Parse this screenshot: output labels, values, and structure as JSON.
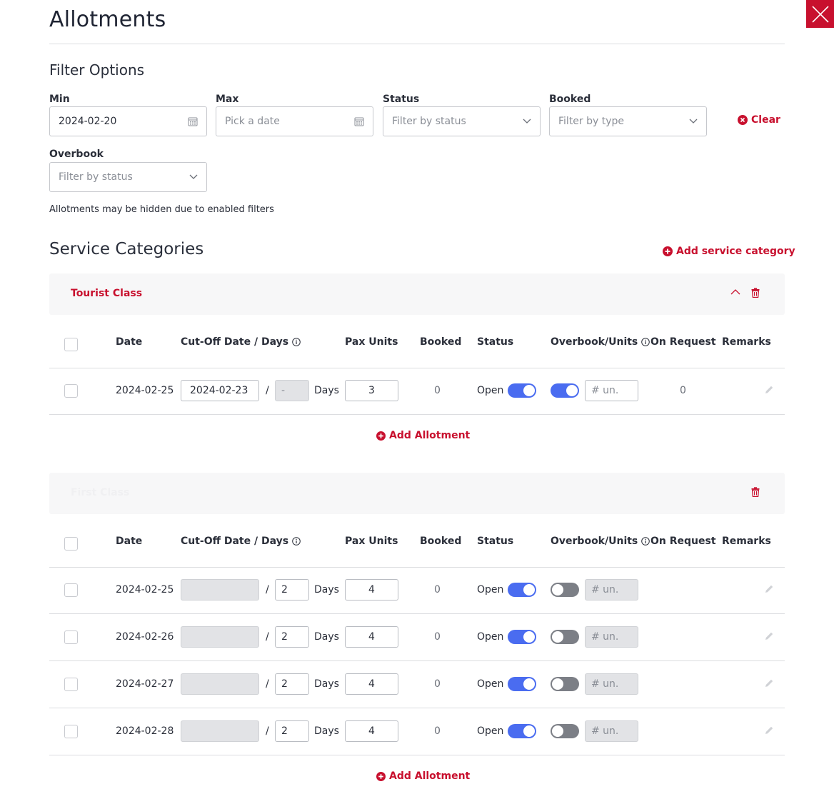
{
  "page": {
    "title": "Allotments"
  },
  "colors": {
    "accent": "#c8102e",
    "toggle_on": "#4a6cf0",
    "toggle_off": "#7c7f86"
  },
  "filters": {
    "section_title": "Filter Options",
    "min": {
      "label": "Min",
      "value": "2024-02-20",
      "icon": "calendar-icon"
    },
    "max": {
      "label": "Max",
      "placeholder": "Pick a date",
      "icon": "calendar-icon"
    },
    "status": {
      "label": "Status",
      "placeholder": "Filter by status"
    },
    "booked": {
      "label": "Booked",
      "placeholder": "Filter by type"
    },
    "overbook": {
      "label": "Overbook",
      "placeholder": "Filter by status"
    },
    "clear_label": "Clear",
    "hint": "Allotments may be hidden due to enabled filters"
  },
  "service": {
    "section_title": "Service Categories",
    "add_label": "Add service category"
  },
  "columns": {
    "date": "Date",
    "cutoff": "Cut-Off Date / Days",
    "pax": "Pax Units",
    "booked": "Booked",
    "status": "Status",
    "overbook": "Overbook/Units",
    "on_request": "On Request",
    "remarks": "Remarks"
  },
  "days_label": "Days",
  "add_allotment_label": "Add Allotment",
  "categories": [
    {
      "name": "Tourist Class",
      "rows": [
        {
          "date": "2024-02-25",
          "cutoff_date": "2024-02-23",
          "cutoff_days": "-",
          "pax": "3",
          "booked": "0",
          "status": "Open",
          "status_on": true,
          "overbook_on": true,
          "units_placeholder": "# un.",
          "on_request": "0"
        }
      ]
    },
    {
      "name": "First Class",
      "rows": [
        {
          "date": "2024-02-25",
          "cutoff_date": "",
          "cutoff_days": "2",
          "pax": "4",
          "booked": "0",
          "status": "Open",
          "status_on": true,
          "overbook_on": false,
          "units_placeholder": "# un.",
          "on_request": ""
        },
        {
          "date": "2024-02-26",
          "cutoff_date": "",
          "cutoff_days": "2",
          "pax": "4",
          "booked": "0",
          "status": "Open",
          "status_on": true,
          "overbook_on": false,
          "units_placeholder": "# un.",
          "on_request": ""
        },
        {
          "date": "2024-02-27",
          "cutoff_date": "",
          "cutoff_days": "2",
          "pax": "4",
          "booked": "0",
          "status": "Open",
          "status_on": true,
          "overbook_on": false,
          "units_placeholder": "# un.",
          "on_request": ""
        },
        {
          "date": "2024-02-28",
          "cutoff_date": "",
          "cutoff_days": "2",
          "pax": "4",
          "booked": "0",
          "status": "Open",
          "status_on": true,
          "overbook_on": false,
          "units_placeholder": "# un.",
          "on_request": ""
        }
      ]
    }
  ]
}
